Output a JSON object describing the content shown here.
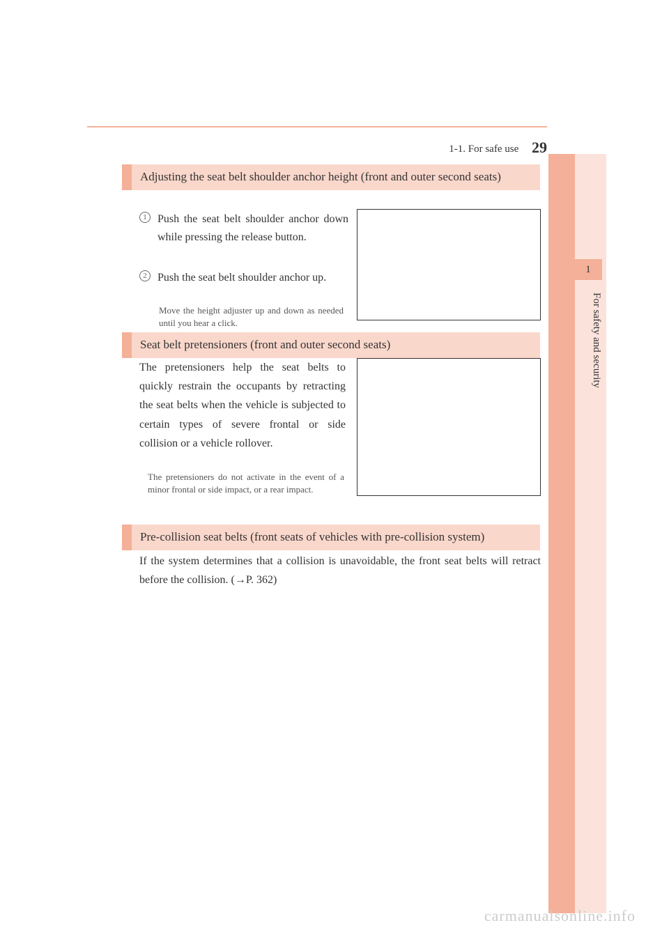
{
  "header": {
    "section": "1-1. For safe use",
    "page": "29"
  },
  "sideTab": {
    "chapter": "1",
    "title": "For safety and security"
  },
  "sections": [
    {
      "heading": "Adjusting the seat belt shoulder anchor height (front and outer second seats)",
      "items": [
        {
          "num": "1",
          "text": "Push the seat belt shoulder anchor down while pressing the release button."
        },
        {
          "num": "2",
          "text": "Push the seat belt shoulder anchor up.",
          "sub": "Move the height adjuster up and down as needed until you hear a click."
        }
      ]
    },
    {
      "heading": "Seat belt pretensioners (front and outer second seats)",
      "para": "The pretensioners help the seat belts to quickly restrain the occupants by retracting the seat belts when the vehicle is subjected to certain types of severe frontal or side collision or a vehicle rollover.",
      "sub": "The pretensioners do not activate in the event of a minor frontal or side impact, or a rear impact."
    },
    {
      "heading": "Pre-collision seat belts (front seats of vehicles with pre-collision system)",
      "para": "If the system determines that a collision is unavoidable, the front seat belts will retract before the collision. (→P. 362)"
    }
  ],
  "watermark": "carmanualsonline.info"
}
